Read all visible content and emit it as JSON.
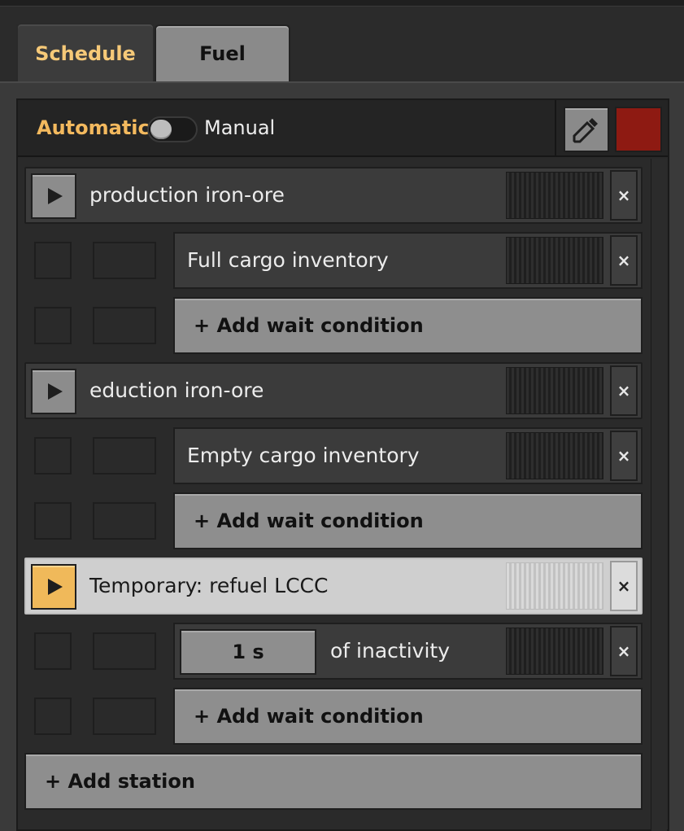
{
  "tabs": [
    {
      "label": "Schedule",
      "active": true
    },
    {
      "label": "Fuel",
      "active": false
    }
  ],
  "mode": {
    "automatic_label": "Automatic",
    "manual_label": "Manual",
    "state": "automatic"
  },
  "toolbar": {
    "picker_icon": "eyedropper-icon",
    "train_color": "#8e1a12"
  },
  "schedule": [
    {
      "station": "production iron-ore",
      "temporary": false,
      "conditions": [
        {
          "label": "Full cargo inventory"
        }
      ],
      "add_condition_label": "+ Add wait condition"
    },
    {
      "station": "eduction iron-ore",
      "temporary": false,
      "conditions": [
        {
          "label": "Empty cargo inventory"
        }
      ],
      "add_condition_label": "+ Add wait condition"
    },
    {
      "station": "Temporary: refuel LCCC",
      "temporary": true,
      "conditions": [
        {
          "time_value": "1 s",
          "label": "of inactivity"
        }
      ],
      "add_condition_label": "+ Add wait condition"
    }
  ],
  "add_station_label": "+ Add station",
  "close_glyph": "×"
}
